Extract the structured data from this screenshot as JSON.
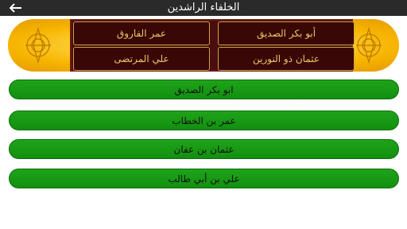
{
  "app_bar": {
    "title": "الخلفاء الراشدين",
    "back_icon": "arrow-left-icon",
    "background": "#2a2a2a"
  },
  "banner": {
    "calligraphy": [
      "أبو بكر الصديق",
      "عمر الفاروق",
      "عثمان ذو النورين",
      "علي المرتضى"
    ],
    "colors": {
      "gold": "#f7b400",
      "maroon": "#4a0e0e"
    }
  },
  "caliphs": [
    {
      "label": "ابو بكر الصديق"
    },
    {
      "label": "عمر بن الخطاب"
    },
    {
      "label": "عثمان بن عفان"
    },
    {
      "label": "علي بن أبي طالب"
    }
  ],
  "colors": {
    "button_green": "#1aa317",
    "button_border": "#0c6f0a"
  }
}
